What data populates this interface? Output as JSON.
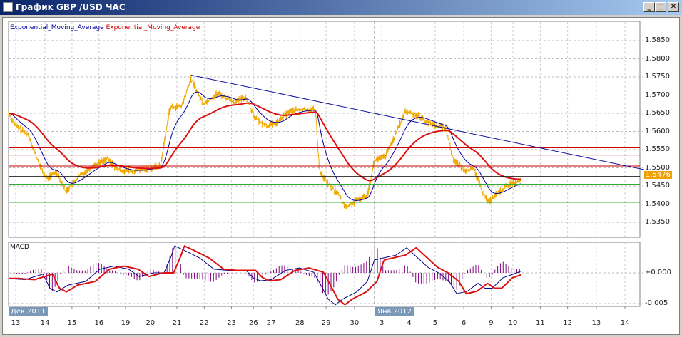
{
  "window": {
    "title": "График GBP /USD  ЧАС",
    "minimize": "_",
    "maximize": "□",
    "close": "✕"
  },
  "legend": {
    "ema1": "Exponential_Moving_Average",
    "ema1_color": "#0000a0",
    "ema2": "Exponential_Moving_Average",
    "ema2_color": "#cc0000"
  },
  "price_axis": [
    "1.5850",
    "1.5800",
    "1.5750",
    "1.5700",
    "1.5650",
    "1.5600",
    "1.5550",
    "1.5500",
    "1.5450",
    "1.5400",
    "1.5350"
  ],
  "current_price": "1.5476",
  "macd": {
    "label": "MACD",
    "axis": [
      "+0.000",
      "-0.005"
    ]
  },
  "x_ticks": [
    "13",
    "14",
    "15",
    "16",
    "19",
    "20",
    "21",
    "22",
    "23",
    "26",
    "27",
    "28",
    "29",
    "30",
    "3",
    "4",
    "5",
    "6",
    "9",
    "10",
    "11",
    "12",
    "13",
    "14"
  ],
  "date_labels": [
    "Дек 2011",
    "Янв 2012"
  ],
  "chart_data": {
    "type": "line",
    "tick_bars": [
      0,
      1.07,
      2.06,
      3.05,
      4.02,
      4.93,
      5.9,
      6.9,
      7.9,
      8.7,
      9.35,
      10.4,
      11.36,
      12.4,
      13.4,
      14.4,
      15.35,
      16.4,
      17.4,
      18.2,
      19.2,
      20.2,
      21.25,
      22.3
    ],
    "ylim": [
      1.532,
      1.5905
    ],
    "price": [
      [
        -0.26,
        1.565
      ],
      [
        0,
        1.5615
      ],
      [
        0.47,
        1.559
      ],
      [
        0.86,
        1.551
      ],
      [
        1.12,
        1.547
      ],
      [
        1.5,
        1.549
      ],
      [
        1.83,
        1.5435
      ],
      [
        2.3,
        1.5475
      ],
      [
        2.82,
        1.5505
      ],
      [
        3.34,
        1.5525
      ],
      [
        3.73,
        1.5495
      ],
      [
        4.26,
        1.549
      ],
      [
        4.65,
        1.5495
      ],
      [
        5.3,
        1.5505
      ],
      [
        5.64,
        1.5665
      ],
      [
        6.08,
        1.567
      ],
      [
        6.42,
        1.5745
      ],
      [
        6.87,
        1.5675
      ],
      [
        7.39,
        1.5705
      ],
      [
        8.04,
        1.568
      ],
      [
        8.43,
        1.5695
      ],
      [
        8.77,
        1.5635
      ],
      [
        9.22,
        1.5615
      ],
      [
        9.6,
        1.5625
      ],
      [
        10.0,
        1.5655
      ],
      [
        10.52,
        1.566
      ],
      [
        10.97,
        1.566
      ],
      [
        11.12,
        1.549
      ],
      [
        11.44,
        1.5455
      ],
      [
        11.83,
        1.5425
      ],
      [
        12.09,
        1.539
      ],
      [
        12.48,
        1.541
      ],
      [
        12.87,
        1.5425
      ],
      [
        13.13,
        1.552
      ],
      [
        13.52,
        1.553
      ],
      [
        13.92,
        1.5595
      ],
      [
        14.26,
        1.5655
      ],
      [
        14.7,
        1.5645
      ],
      [
        15.09,
        1.5625
      ],
      [
        15.48,
        1.5615
      ],
      [
        15.74,
        1.561
      ],
      [
        16.0,
        1.5525
      ],
      [
        16.4,
        1.5495
      ],
      [
        16.79,
        1.5495
      ],
      [
        17.05,
        1.544
      ],
      [
        17.31,
        1.5405
      ],
      [
        17.7,
        1.5435
      ],
      [
        18.09,
        1.5455
      ],
      [
        18.51,
        1.5465
      ]
    ],
    "hlines": [
      {
        "value": 1.5555,
        "color": "#cc0000"
      },
      {
        "value": 1.5535,
        "color": "#cc0000"
      },
      {
        "value": 1.5505,
        "color": "#cc0000"
      },
      {
        "value": 1.5476,
        "color": "#000000"
      },
      {
        "value": 1.5455,
        "color": "#33aa33"
      },
      {
        "value": 1.5405,
        "color": "#33aa33"
      }
    ],
    "trendline": [
      [
        6.42,
        1.5755
      ],
      [
        23.0,
        1.5495
      ]
    ],
    "macd_ylim": [
      -0.0058,
      0.0053
    ],
    "macd_line": [
      [
        -0.26,
        -0.0009
      ],
      [
        0,
        -0.001
      ],
      [
        0.34,
        -0.0011
      ],
      [
        1.0,
        -0.0002
      ],
      [
        1.25,
        -0.0025
      ],
      [
        1.51,
        -0.0031
      ],
      [
        1.91,
        -0.002
      ],
      [
        2.56,
        -0.0014
      ],
      [
        3.08,
        0.0006
      ],
      [
        3.6,
        0.0011
      ],
      [
        4.13,
        0.0006
      ],
      [
        4.52,
        -0.0006
      ],
      [
        5.04,
        0
      ],
      [
        5.43,
        0
      ],
      [
        5.69,
        0.0027
      ],
      [
        5.82,
        0.0044
      ],
      [
        6.21,
        0.0036
      ],
      [
        6.74,
        0.0024
      ],
      [
        7.26,
        0.0006
      ],
      [
        7.78,
        0.0004
      ],
      [
        8.43,
        0.0004
      ],
      [
        8.69,
        -0.0008
      ],
      [
        8.96,
        -0.0013
      ],
      [
        9.35,
        -0.0011
      ],
      [
        9.87,
        0.0004
      ],
      [
        10.39,
        0.0008
      ],
      [
        10.91,
        0.0001
      ],
      [
        11.17,
        -0.002
      ],
      [
        11.44,
        -0.0043
      ],
      [
        11.7,
        -0.0052
      ],
      [
        11.96,
        -0.0043
      ],
      [
        12.48,
        -0.0031
      ],
      [
        12.87,
        -0.0014
      ],
      [
        13.13,
        0.0021
      ],
      [
        13.52,
        0.0025
      ],
      [
        13.92,
        0.0029
      ],
      [
        14.31,
        0.0041
      ],
      [
        14.7,
        0.0025
      ],
      [
        15.09,
        0.0009
      ],
      [
        15.48,
        0
      ],
      [
        15.87,
        -0.0014
      ],
      [
        16.14,
        -0.0034
      ],
      [
        16.53,
        -0.003
      ],
      [
        16.92,
        -0.0017
      ],
      [
        17.18,
        -0.0025
      ],
      [
        17.44,
        -0.0025
      ],
      [
        17.83,
        -0.0008
      ],
      [
        18.22,
        -0.0002
      ],
      [
        18.51,
        0.0003
      ]
    ]
  }
}
